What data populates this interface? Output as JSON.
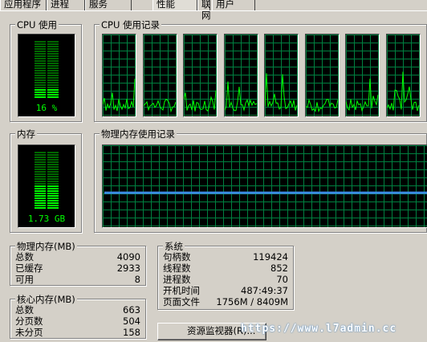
{
  "tabs": [
    {
      "label": "应用程序"
    },
    {
      "label": "进程"
    },
    {
      "label": "服务"
    },
    {
      "label": "性能"
    },
    {
      "label": "联网"
    },
    {
      "label": "用户"
    }
  ],
  "cpu_usage": {
    "title": "CPU 使用",
    "percent_label": "16 %",
    "percent": 16
  },
  "cpu_history": {
    "title": "CPU 使用记录",
    "cores": 8
  },
  "memory": {
    "title": "内存",
    "value_label": "1.73 GB",
    "fraction": 0.42
  },
  "memory_history": {
    "title": "物理内存使用记录",
    "level_fraction": 0.42
  },
  "physical_memory": {
    "title": "物理内存(MB)",
    "rows": [
      {
        "label": "总数",
        "value": "4090"
      },
      {
        "label": "已缓存",
        "value": "2933"
      },
      {
        "label": "可用",
        "value": "8"
      }
    ]
  },
  "kernel_memory": {
    "title": "核心内存(MB)",
    "rows": [
      {
        "label": "总数",
        "value": "663"
      },
      {
        "label": "分页数",
        "value": "504"
      },
      {
        "label": "未分页",
        "value": "158"
      }
    ]
  },
  "system": {
    "title": "系统",
    "rows": [
      {
        "label": "句柄数",
        "value": "119424"
      },
      {
        "label": "线程数",
        "value": "852"
      },
      {
        "label": "进程数",
        "value": "70"
      },
      {
        "label": "开机时间",
        "value": "487:49:37"
      },
      {
        "label": "页面文件",
        "value": "1756M / 8409M"
      }
    ]
  },
  "resource_monitor_button": {
    "label": "资源监视器(R)..."
  },
  "watermark": "https://www.l7admin.cc",
  "colors": {
    "graph_grid": "#008040",
    "graph_line": "#00ff00",
    "mem_line": "#3c8ce6",
    "meter_dim": "#006600",
    "meter_on": "#00ff00"
  }
}
